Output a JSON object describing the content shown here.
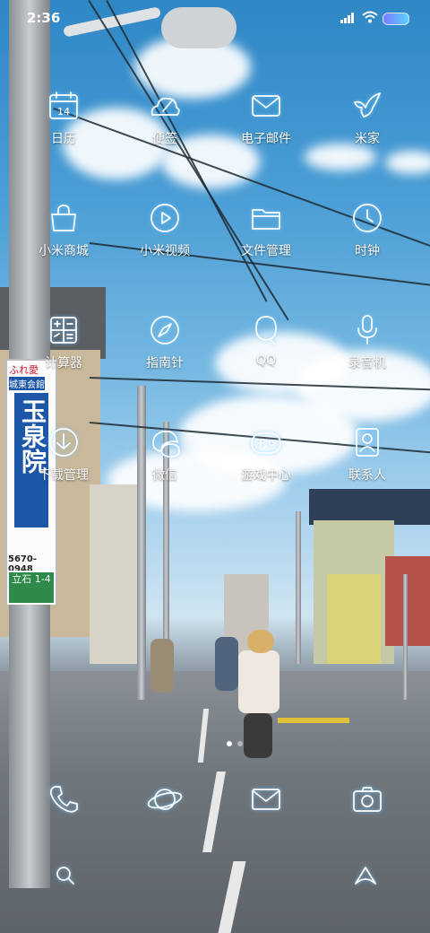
{
  "status_bar": {
    "time": "2:36"
  },
  "apps": [
    {
      "label": "日历",
      "icon": "calendar-icon",
      "glyph_text": "14"
    },
    {
      "label": "便签",
      "icon": "notes-icon"
    },
    {
      "label": "电子邮件",
      "icon": "email-icon"
    },
    {
      "label": "米家",
      "icon": "mijia-bird-icon"
    },
    {
      "label": "小米商城",
      "icon": "shopping-bag-icon"
    },
    {
      "label": "小米视频",
      "icon": "video-play-icon"
    },
    {
      "label": "文件管理",
      "icon": "folder-icon"
    },
    {
      "label": "时钟",
      "icon": "clock-icon"
    },
    {
      "label": "计算器",
      "icon": "calculator-icon"
    },
    {
      "label": "指南针",
      "icon": "compass-icon"
    },
    {
      "label": "QQ",
      "icon": "qq-icon"
    },
    {
      "label": "录音机",
      "icon": "microphone-icon"
    },
    {
      "label": "下载管理",
      "icon": "download-icon"
    },
    {
      "label": "微信",
      "icon": "wechat-icon"
    },
    {
      "label": "游戏中心",
      "icon": "gamepad-icon"
    },
    {
      "label": "联系人",
      "icon": "contacts-icon"
    }
  ],
  "page_indicator": {
    "pages": 2,
    "current": 1
  },
  "dock": [
    {
      "icon": "phone-icon"
    },
    {
      "icon": "browser-planet-icon"
    },
    {
      "icon": "messages-icon"
    },
    {
      "icon": "camera-icon"
    }
  ],
  "bottom_bar": [
    {
      "icon": "search-icon"
    },
    {
      "icon": "app-vault-icon"
    }
  ],
  "wallpaper": {
    "sign_text_top": "ふれ愛",
    "sign_text_mid": "城東会館",
    "sign_text_main": "玉泉院",
    "sign_text_phone": "5670-0948",
    "sign_text_address": "立石 1-4",
    "colors": {
      "sky": "#3b93cf",
      "sign_blue": "#1d58a8",
      "sign_green": "#2d8a4a"
    }
  }
}
